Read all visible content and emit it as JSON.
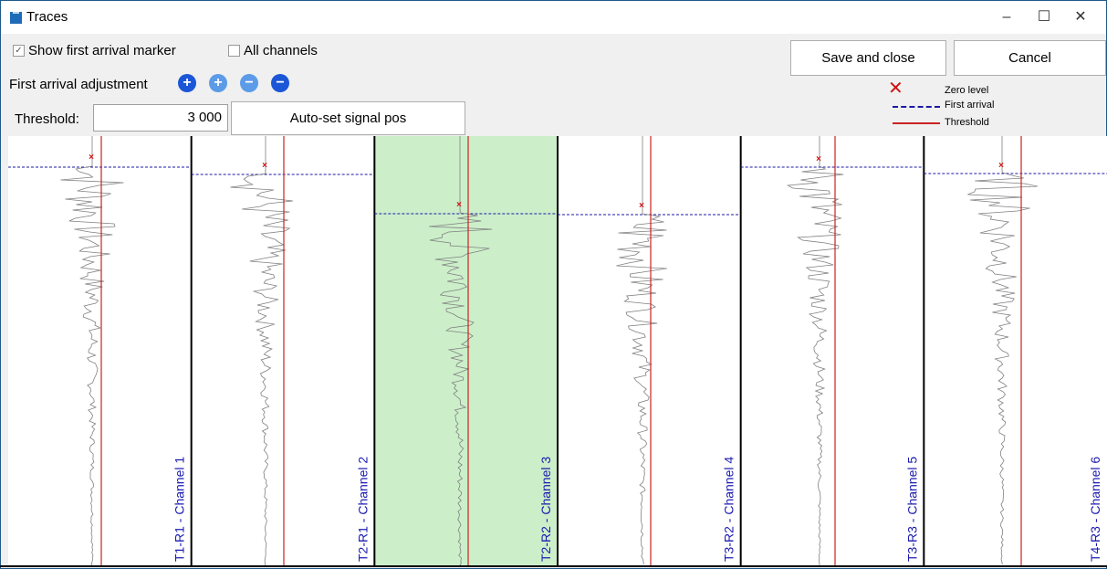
{
  "window": {
    "title": "Traces",
    "minimize": "–",
    "maximize": "☐",
    "close": "✕"
  },
  "toolbar": {
    "show_marker_label": "Show first arrival marker",
    "show_marker_checked": true,
    "all_channels_label": "All channels",
    "all_channels_checked": false,
    "adjustment_label": "First arrival adjustment",
    "threshold_label": "Threshold:",
    "threshold_value": "3 000",
    "auto_set_label": "Auto-set signal pos",
    "save_label": "Save and close",
    "cancel_label": "Cancel"
  },
  "legend": {
    "zero_level": "Zero level",
    "first_arrival": "First arrival",
    "threshold": "Threshold"
  },
  "colors": {
    "threshold_line": "#cc2222",
    "first_arrival_line": "#1a1aa6",
    "marker": "#d01010",
    "trace": "#808080",
    "selected_bg": "#ccefca",
    "label_text": "#1a1ab0",
    "adjust_dark": "#1a56d6",
    "adjust_light": "#5b9be8"
  },
  "channels": [
    {
      "label": "T1-R1 - Channel 1",
      "selected": false
    },
    {
      "label": "T2-R1 - Channel 2",
      "selected": false
    },
    {
      "label": "T2-R2 - Channel 3",
      "selected": true
    },
    {
      "label": "T3-R2 - Channel 4",
      "selected": false
    },
    {
      "label": "T3-R3 - Channel 5",
      "selected": false
    },
    {
      "label": "T4-R3 - Channel 6",
      "selected": false
    }
  ]
}
